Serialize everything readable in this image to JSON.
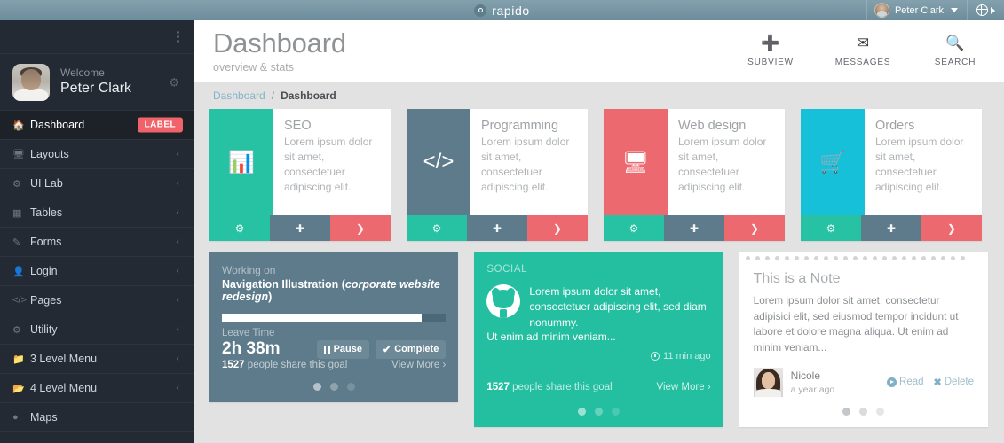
{
  "topbar": {
    "brand": "rapido",
    "brand_icon": "circle-dot-icon",
    "user_name": "Peter Clark",
    "user_caret_icon": "chevron-down-icon",
    "globe_icon": "globe-icon",
    "globe_arrow_icon": "caret-right-icon"
  },
  "sidebar": {
    "menu_icon": "ellipsis-vertical-icon",
    "welcome_label": "Welcome",
    "user_name": "Peter Clark",
    "settings_icon": "gear-icon",
    "items": [
      {
        "label": "Dashboard",
        "icon": "home-icon",
        "badge": "LABEL",
        "active": true,
        "caret": false
      },
      {
        "label": "Layouts",
        "icon": "monitor-icon",
        "badge": "",
        "active": false,
        "caret": true
      },
      {
        "label": "UI Lab",
        "icon": "share-nodes-icon",
        "badge": "",
        "active": false,
        "caret": true
      },
      {
        "label": "Tables",
        "icon": "grid-icon",
        "badge": "",
        "active": false,
        "caret": true
      },
      {
        "label": "Forms",
        "icon": "pencil-square-icon",
        "badge": "",
        "active": false,
        "caret": true
      },
      {
        "label": "Login",
        "icon": "user-icon",
        "badge": "",
        "active": false,
        "caret": true
      },
      {
        "label": "Pages",
        "icon": "code-icon",
        "badge": "",
        "active": false,
        "caret": true
      },
      {
        "label": "Utility",
        "icon": "gears-icon",
        "badge": "",
        "active": false,
        "caret": true
      },
      {
        "label": "3 Level Menu",
        "icon": "folder-icon",
        "badge": "",
        "active": false,
        "caret": true
      },
      {
        "label": "4 Level Menu",
        "icon": "folder-open-icon",
        "badge": "",
        "active": false,
        "caret": true
      },
      {
        "label": "Maps",
        "icon": "map-pin-icon",
        "badge": "",
        "active": false,
        "caret": false
      }
    ],
    "caret_icon": "chevron-left-icon"
  },
  "header": {
    "title": "Dashboard",
    "subtitle": "overview & stats",
    "actions": [
      {
        "label": "SUBVIEW",
        "icon": "plus-icon"
      },
      {
        "label": "MESSAGES",
        "icon": "envelope-icon"
      },
      {
        "label": "SEARCH",
        "icon": "search-icon"
      }
    ]
  },
  "breadcrumb": {
    "root": "Dashboard",
    "separator": "/",
    "current": "Dashboard"
  },
  "tiles": [
    {
      "title": "SEO",
      "desc": "Lorem ipsum dolor sit amet, consectetuer adipiscing elit.",
      "icon": "bar-chart-icon",
      "icon_bg": "#26c2a3",
      "actions": [
        "gear-icon",
        "plus-icon",
        "chevron-right-icon"
      ]
    },
    {
      "title": "Programming",
      "desc": "Lorem ipsum dolor sit amet, consectetuer adipiscing elit.",
      "icon": "code-brackets-icon",
      "icon_bg": "#5d7b8a",
      "actions": [
        "gear-icon",
        "plus-icon",
        "chevron-right-icon"
      ]
    },
    {
      "title": "Web design",
      "desc": "Lorem ipsum dolor sit amet, consectetuer adipiscing elit.",
      "icon": "desktop-icon",
      "icon_bg": "#ec6a6f",
      "actions": [
        "gear-icon",
        "plus-icon",
        "chevron-right-icon"
      ]
    },
    {
      "title": "Orders",
      "desc": "Lorem ipsum dolor sit amet, consectetuer adipiscing elit.",
      "icon": "shopping-cart-icon",
      "icon_bg": "#15c0d8",
      "actions": [
        "gear-icon",
        "plus-icon",
        "chevron-right-icon"
      ]
    }
  ],
  "working_panel": {
    "kicker": "Working on",
    "task_prefix": "Navigation Illustration (",
    "task_emphasis": "corporate website redesign",
    "task_suffix": ")",
    "progress_percent": 89,
    "leave_label": "Leave Time",
    "time_value": "2h 38m",
    "pause_label": "Pause",
    "pause_icon": "pause-icon",
    "complete_label": "Complete",
    "complete_icon": "check-icon",
    "share_count": "1527",
    "share_text": "people share this goal",
    "view_more": "View More",
    "view_more_icon": "chevron-right-icon",
    "pager_dots": 3,
    "pager_active": 0
  },
  "social_panel": {
    "kicker": "SOCIAL",
    "avatar_icon": "github-icon",
    "text": "Lorem ipsum dolor sit amet, consectetuer adipiscing elit, sed diam nonummy.",
    "text2": "Ut enim ad minim veniam...",
    "time_icon": "clock-icon",
    "time_label": "11 min ago",
    "share_count": "1527",
    "share_text": "people share this goal",
    "view_more": "View More",
    "view_more_icon": "chevron-right-icon",
    "pager_dots": 3,
    "pager_active": 0
  },
  "note_panel": {
    "title": "This is a Note",
    "text": "Lorem ipsum dolor sit amet, consectetur adipisici elit, sed eiusmod tempor incidunt ut labore et dolore magna aliqua. Ut enim ad minim veniam...",
    "author": "Nicole",
    "author_avatar": "nicole-avatar",
    "timestamp": "a year ago",
    "read_label": "Read",
    "read_icon": "circle-play-icon",
    "delete_label": "Delete",
    "delete_icon": "close-x-icon",
    "pager_dots": 3,
    "pager_active": 0
  },
  "colors": {
    "topbar": "#6d8d9c",
    "sidebar": "#242a33",
    "accent_teal": "#26c2a3",
    "accent_slate": "#5d7b8a",
    "accent_red": "#ec6a6f",
    "accent_cyan": "#15c0d8",
    "badge_red": "#f1636a",
    "page_bg": "#e2e2e2",
    "link_blue": "#84b4c8"
  }
}
